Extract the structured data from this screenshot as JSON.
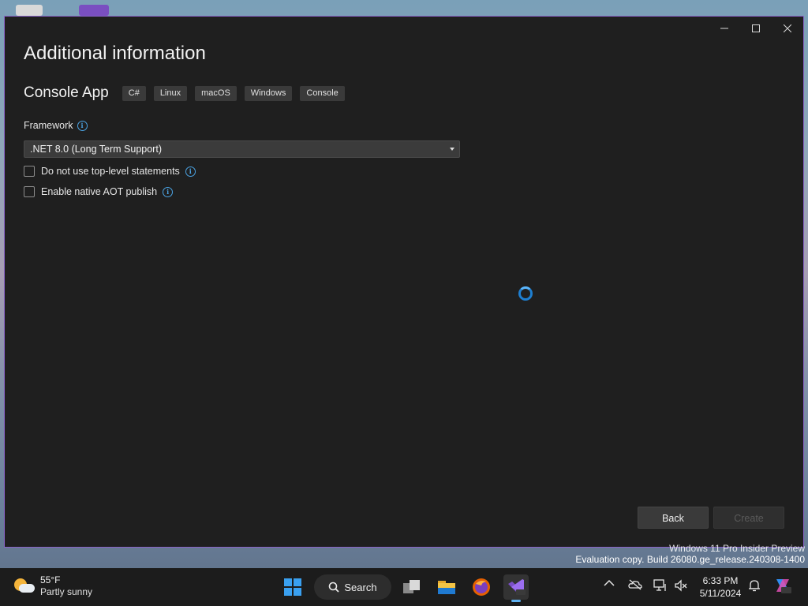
{
  "window": {
    "heading": "Additional information",
    "controls": {
      "minimize": "minimize-icon",
      "maximize": "maximize-icon",
      "close": "close-icon"
    }
  },
  "template": {
    "name": "Console App",
    "tags": [
      "C#",
      "Linux",
      "macOS",
      "Windows",
      "Console"
    ]
  },
  "framework": {
    "label": "Framework",
    "selected": ".NET 8.0 (Long Term Support)"
  },
  "options": [
    {
      "label": "Do not use top-level statements",
      "checked": false
    },
    {
      "label": "Enable native AOT publish",
      "checked": false
    }
  ],
  "buttons": {
    "back": "Back",
    "create": "Create"
  },
  "watermark": {
    "line1": "Windows 11 Pro Insider Preview",
    "line2": "Evaluation copy. Build 26080.ge_release.240308-1400"
  },
  "taskbar": {
    "weather": {
      "temp": "55°F",
      "condition": "Partly sunny"
    },
    "search_label": "Search",
    "clock": {
      "time": "6:33 PM",
      "date": "5/11/2024"
    }
  },
  "colors": {
    "accent": "#4ba3e3",
    "window_border": "#8a63c9",
    "window_bg": "#1f1f1f",
    "taskbar_bg": "#1c1c1c"
  }
}
